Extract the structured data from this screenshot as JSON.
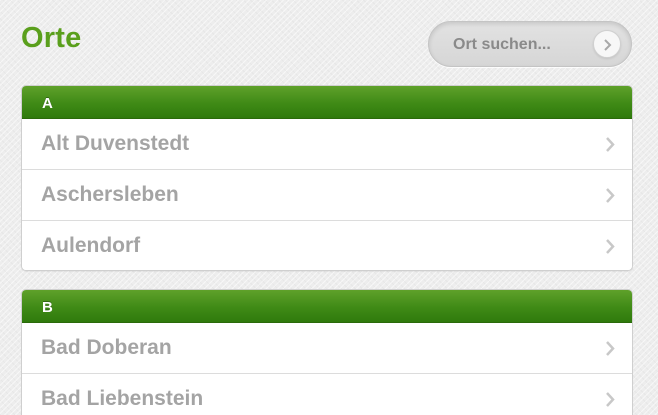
{
  "header": {
    "title": "Orte",
    "search_label": "Ort suchen..."
  },
  "sections": [
    {
      "letter": "A",
      "items": [
        "Alt Duvenstedt",
        "Aschersleben",
        "Aulendorf"
      ]
    },
    {
      "letter": "B",
      "items": [
        "Bad Doberan",
        "Bad Liebenstein"
      ]
    }
  ],
  "colors": {
    "accent": "#5a9f1c",
    "header_green": "#3f8a16",
    "item_text": "#a4a4a4"
  },
  "icons": {
    "row_chevron": "chevron-right-icon",
    "search_arrow": "chevron-right-icon"
  }
}
